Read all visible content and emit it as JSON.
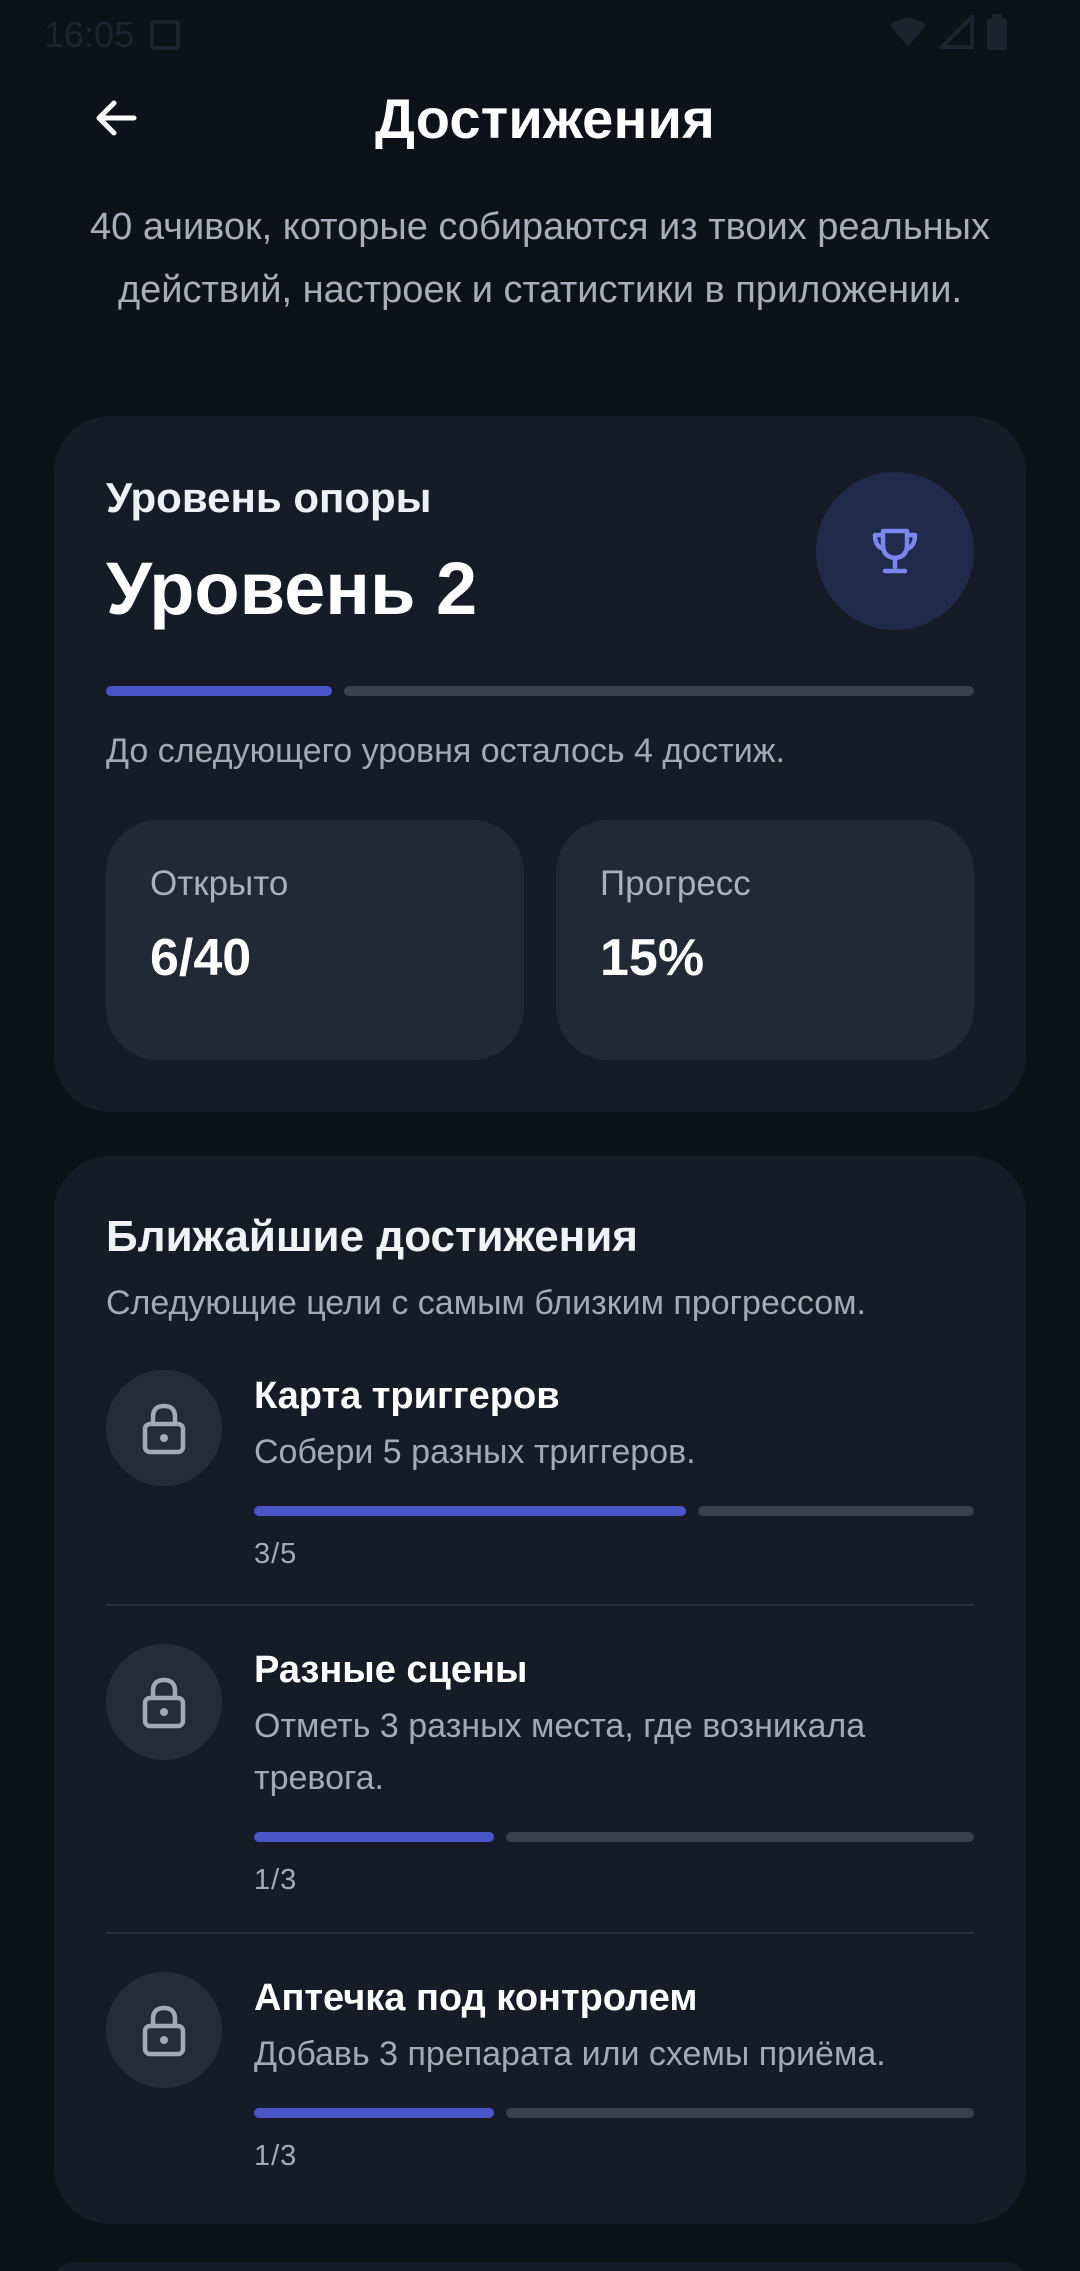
{
  "status_bar": {
    "time": "16:05"
  },
  "header": {
    "title": "Достижения"
  },
  "subtitle": "40 ачивок, которые собираются из твоих реальных действий, настроек и статистики в приложении.",
  "level_card": {
    "label": "Уровень опоры",
    "value": "Уровень 2",
    "progress_fraction": 0.26,
    "next_level_text": "До следующего уровня осталось 4 достиж.",
    "stats": {
      "open_label": "Открыто",
      "open_value": "6/40",
      "progress_label": "Прогресс",
      "progress_value": "15%"
    }
  },
  "nearest": {
    "title": "Ближайшие достижения",
    "description": "Следующие цели с самым близким прогрессом.",
    "items": [
      {
        "title": "Карта триггеров",
        "description": "Собери 5 разных триггеров.",
        "count": "3/5",
        "progress": 0.6
      },
      {
        "title": "Разные сцены",
        "description": "Отметь 3 разных места, где возникала тревога.",
        "count": "1/3",
        "progress": 0.3333
      },
      {
        "title": "Аптечка под контролем",
        "description": "Добавь 3 препарата или схемы приёма.",
        "count": "1/3",
        "progress": 0.3333
      }
    ]
  },
  "colors": {
    "background": "#0d1118",
    "card": "#161c27",
    "accent": "#4a55c9",
    "track": "#3b3f4e",
    "trophy": "#7b86ee"
  },
  "icons": {
    "back": "arrow-left-icon",
    "trophy": "trophy-icon",
    "lock": "lock-icon"
  }
}
